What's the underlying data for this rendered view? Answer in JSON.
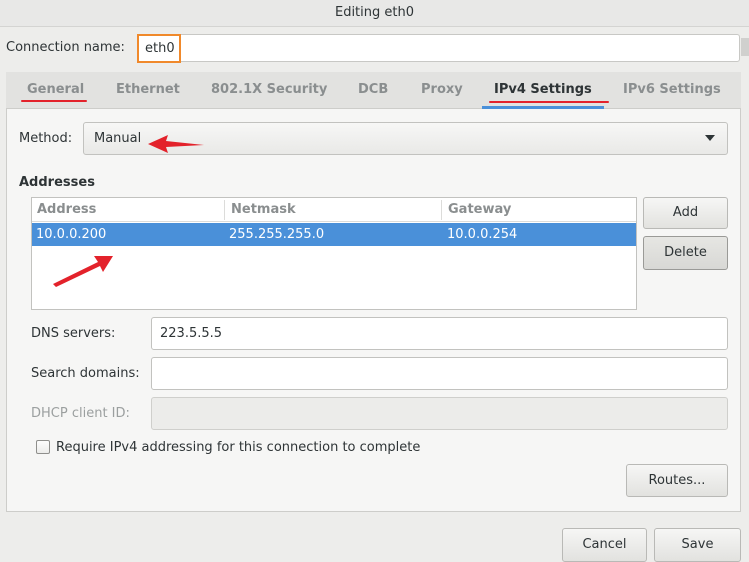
{
  "window": {
    "title": "Editing eth0"
  },
  "connection": {
    "label": "Connection name:",
    "value": "eth0"
  },
  "tabs": [
    {
      "label": "General"
    },
    {
      "label": "Ethernet"
    },
    {
      "label": "802.1X Security"
    },
    {
      "label": "DCB"
    },
    {
      "label": "Proxy"
    },
    {
      "label": "IPv4 Settings",
      "active": true
    },
    {
      "label": "IPv6 Settings"
    }
  ],
  "ipv4": {
    "method_label": "Method:",
    "method_value": "Manual",
    "addresses_title": "Addresses",
    "columns": [
      "Address",
      "Netmask",
      "Gateway"
    ],
    "rows": [
      {
        "address": "10.0.0.200",
        "netmask": "255.255.255.0",
        "gateway": "10.0.0.254"
      }
    ],
    "add_label": "Add",
    "delete_label": "Delete",
    "dns_label": "DNS servers:",
    "dns_value": "223.5.5.5",
    "search_label": "Search domains:",
    "search_value": "",
    "dhcp_label": "DHCP client ID:",
    "dhcp_value": "",
    "require_label": "Require IPv4 addressing for this connection to complete",
    "routes_label": "Routes..."
  },
  "footer": {
    "cancel_label": "Cancel",
    "save_label": "Save"
  },
  "colors": {
    "accent": "#4a90d9",
    "annotation": "#e3222b",
    "highlight": "#f0892b"
  }
}
